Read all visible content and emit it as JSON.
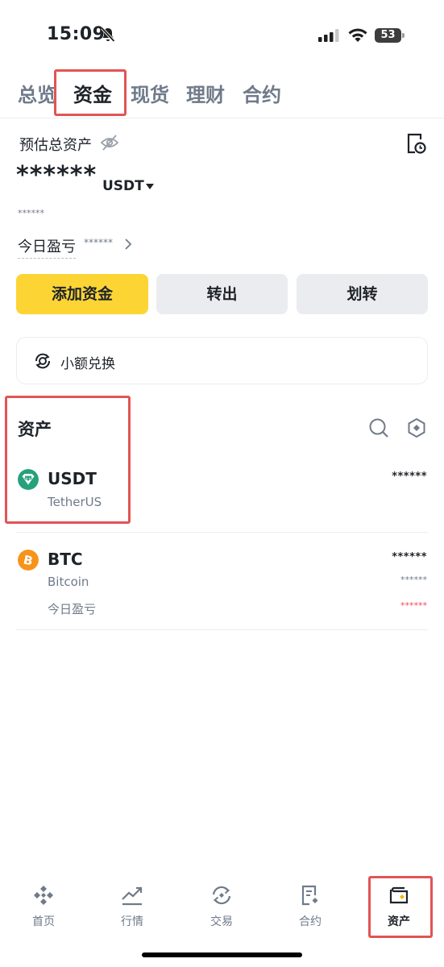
{
  "status_bar": {
    "time": "15:09",
    "battery": "53"
  },
  "tabs": [
    {
      "label": "总览"
    },
    {
      "label": "资金"
    },
    {
      "label": "现货"
    },
    {
      "label": "理财"
    },
    {
      "label": "合约"
    }
  ],
  "active_tab": "资金",
  "summary": {
    "estimated_label": "预估总资产",
    "balance_masked": "******",
    "unit": "USDT",
    "sub_masked": "******",
    "pnl_label": "今日盈亏",
    "pnl_masked": "******"
  },
  "actions": {
    "add_funds": "添加资金",
    "transfer_out": "转出",
    "transfer": "划转"
  },
  "dust": {
    "label": "小额兑换"
  },
  "assets": {
    "title": "资产",
    "items": [
      {
        "symbol": "USDT",
        "name": "TetherUS",
        "amount_masked": "******",
        "icon_color": "#26a17b"
      },
      {
        "symbol": "BTC",
        "name": "Bitcoin",
        "amount_masked": "******",
        "sub_masked": "******",
        "pnl_label": "今日盈亏",
        "pnl_masked": "******",
        "icon_color": "#f7931a"
      }
    ]
  },
  "bottom_nav": [
    {
      "label": "首页",
      "icon": "binance-logo-icon"
    },
    {
      "label": "行情",
      "icon": "chart-trend-icon"
    },
    {
      "label": "交易",
      "icon": "exchange-icon"
    },
    {
      "label": "合约",
      "icon": "futures-doc-icon"
    },
    {
      "label": "资产",
      "icon": "wallet-icon"
    }
  ],
  "colors": {
    "accent": "#fcd535",
    "highlight": "#e25454",
    "loss": "#f6465d"
  }
}
